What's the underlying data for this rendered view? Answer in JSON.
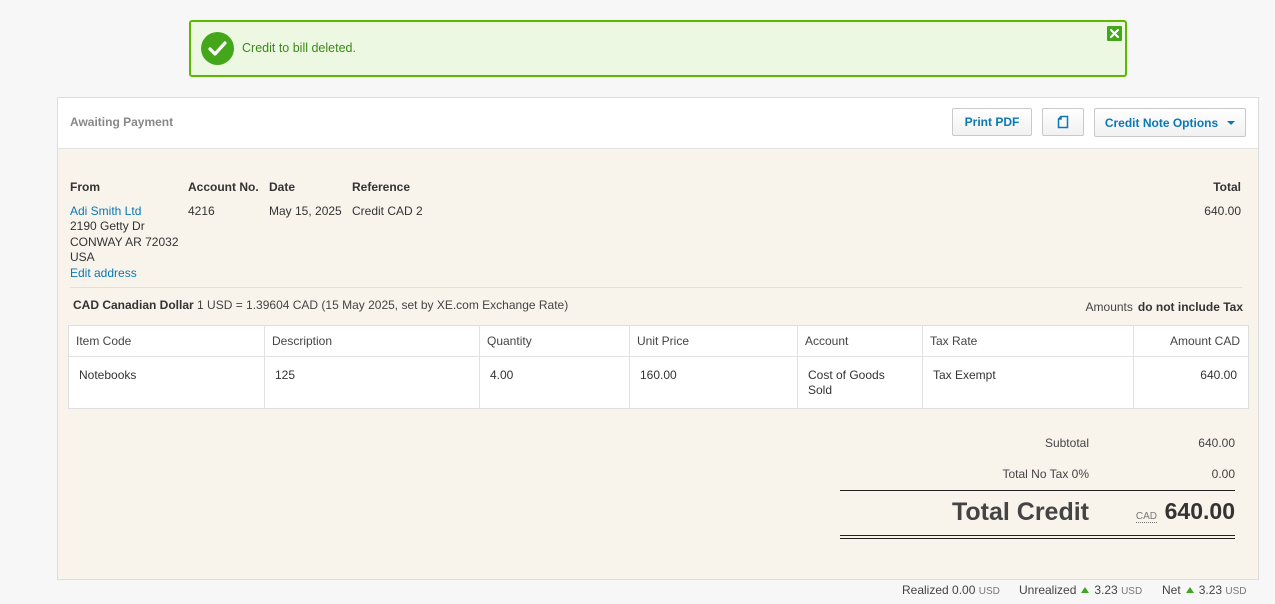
{
  "notice": {
    "message": "Credit to bill deleted."
  },
  "header": {
    "status": "Awaiting Payment",
    "print_label": "Print PDF",
    "copy_icon": "copy-icon",
    "options_label": "Credit Note Options"
  },
  "details": {
    "from_label": "From",
    "from_name": "Adi Smith Ltd",
    "address_line1": "2190 Getty Dr",
    "address_line2": "CONWAY AR 72032",
    "address_line3": "USA",
    "edit_address": "Edit address",
    "account_label": "Account No.",
    "account_value": "4216",
    "date_label": "Date",
    "date_value": "May 15, 2025",
    "reference_label": "Reference",
    "reference_value": "Credit CAD 2",
    "total_label": "Total",
    "total_value": "640.00"
  },
  "currency": {
    "name": "CAD Canadian Dollar",
    "rate": "1 USD = 1.39604 CAD (15 May 2025, set by XE.com Exchange Rate)",
    "amounts_prefix": "Amounts",
    "amounts_tax": "do not include Tax"
  },
  "table": {
    "headers": [
      "Item Code",
      "Description",
      "Quantity",
      "Unit Price",
      "Account",
      "Tax Rate",
      "Amount CAD"
    ],
    "rows": [
      {
        "item_code": "Notebooks",
        "description": "125",
        "quantity": "4.00",
        "unit_price": "160.00",
        "account_line1": "Cost of Goods",
        "account_line2": "Sold",
        "tax_rate": "Tax Exempt",
        "amount": "640.00"
      }
    ]
  },
  "totals": {
    "subtotal_label": "Subtotal",
    "subtotal_value": "640.00",
    "tax_label": "Total No Tax 0%",
    "tax_value": "0.00",
    "grand_label": "Total Credit",
    "grand_currency": "CAD",
    "grand_value": "640.00"
  },
  "footer": {
    "realized_label": "Realized",
    "realized_value": "0.00",
    "realized_unit": "USD",
    "unrealized_label": "Unrealized",
    "unrealized_value": "3.23",
    "unrealized_unit": "USD",
    "net_label": "Net",
    "net_value": "3.23",
    "net_unit": "USD"
  },
  "colors": {
    "accent": "#0b78b4",
    "success": "#44a61b",
    "up_arrow": "#3fa524"
  }
}
